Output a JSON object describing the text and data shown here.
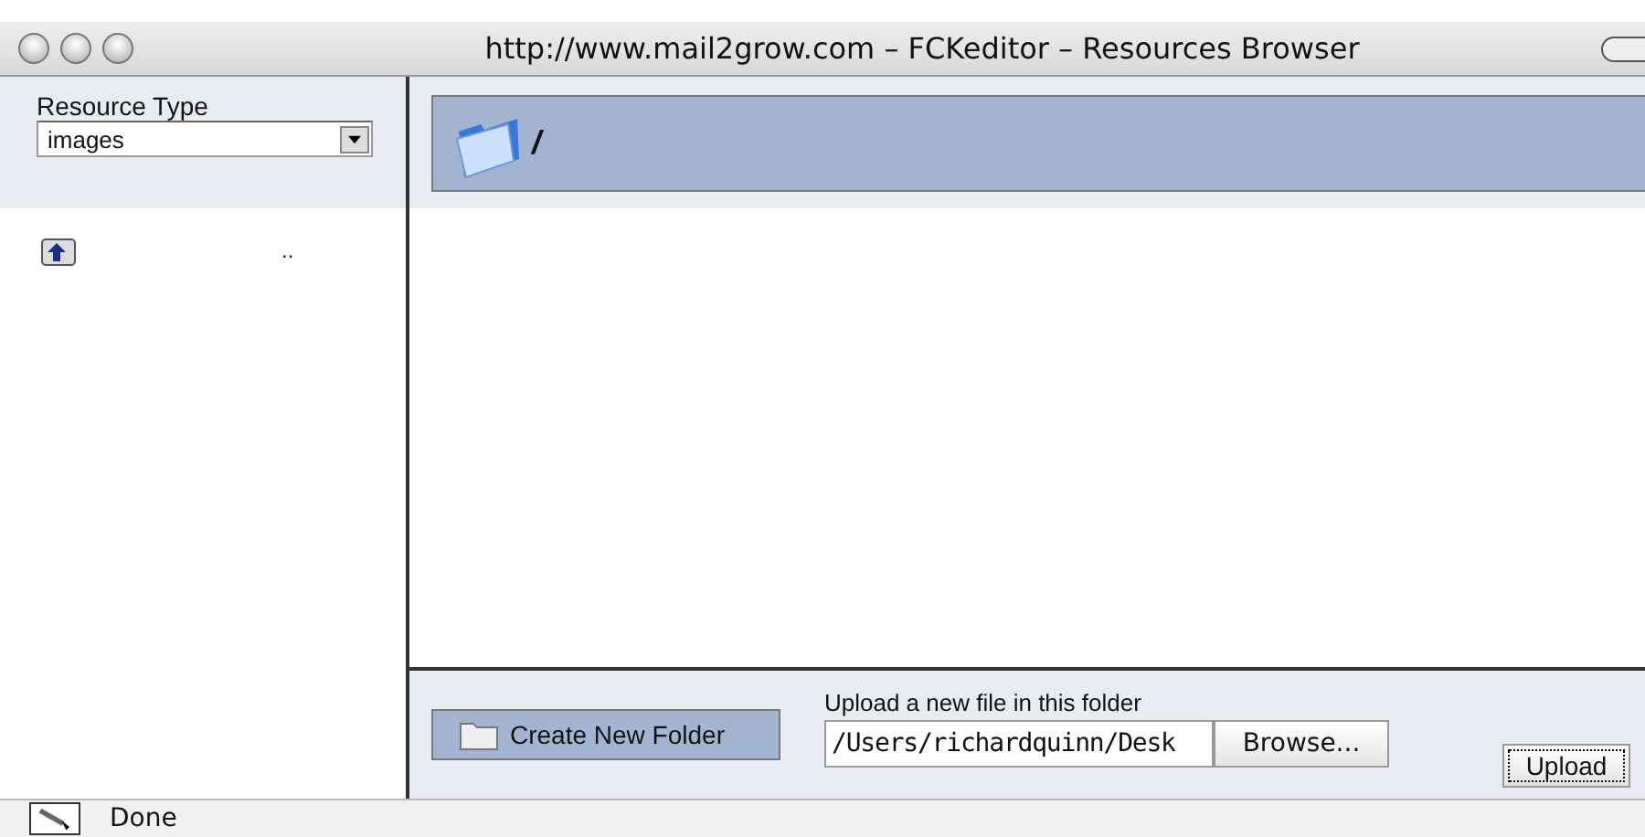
{
  "window": {
    "title": "http://www.mail2grow.com – FCKeditor – Resources Browser"
  },
  "sidebar": {
    "label": "Resource Type",
    "select_value": "images",
    "items": [
      {
        "name": ".."
      }
    ]
  },
  "header": {
    "path": "/"
  },
  "footer": {
    "create_folder": "Create New Folder",
    "upload_label": "Upload a new file in this folder",
    "file_value": "/Users/richardquinn/Desk",
    "browse": "Browse...",
    "upload": "Upload"
  },
  "status_bar": {
    "text": "Done"
  }
}
